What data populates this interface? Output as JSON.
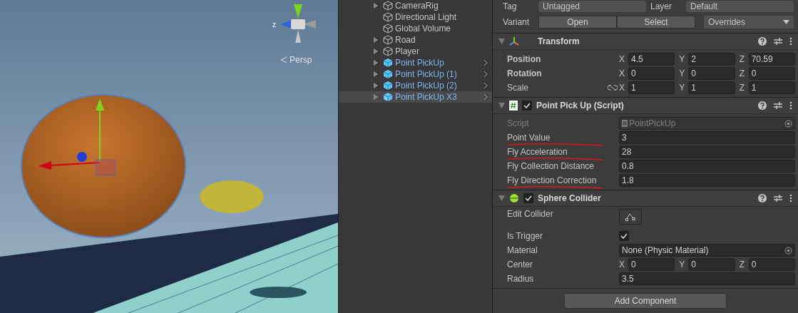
{
  "scene": {
    "axis_label": "z",
    "projection": "Persp"
  },
  "hierarchy": {
    "items": [
      {
        "name": "CameraRig",
        "kind": "object",
        "expandable": true,
        "submenu": false,
        "selected": false
      },
      {
        "name": "Directional Light",
        "kind": "object",
        "expandable": false,
        "submenu": false,
        "selected": false
      },
      {
        "name": "Global Volume",
        "kind": "object",
        "expandable": false,
        "submenu": false,
        "selected": false
      },
      {
        "name": "Road",
        "kind": "object",
        "expandable": true,
        "submenu": false,
        "selected": false
      },
      {
        "name": "Player",
        "kind": "object",
        "expandable": true,
        "submenu": false,
        "selected": false
      },
      {
        "name": "Point PickUp",
        "kind": "prefab",
        "expandable": true,
        "submenu": true,
        "selected": false
      },
      {
        "name": "Point PickUp (1)",
        "kind": "prefab",
        "expandable": true,
        "submenu": true,
        "selected": false
      },
      {
        "name": "Point PickUp (2)",
        "kind": "prefab",
        "expandable": true,
        "submenu": true,
        "selected": false
      },
      {
        "name": "Point PickUp X3",
        "kind": "variant",
        "expandable": true,
        "submenu": true,
        "selected": true
      }
    ]
  },
  "inspector": {
    "tag": {
      "label": "Tag",
      "value": "Untagged"
    },
    "layer": {
      "label": "Layer",
      "value": "Default"
    },
    "variant": {
      "label": "Variant",
      "buttons": [
        "Open",
        "Select"
      ],
      "overrides": "Overrides"
    },
    "components": [
      {
        "title": "Transform",
        "kind": "transform",
        "rows": [
          {
            "kind": "vector",
            "label": "Position",
            "bold": true,
            "axes": [
              {
                "axis": "X",
                "value": "4.5"
              },
              {
                "axis": "Y",
                "value": "2"
              },
              {
                "axis": "Z",
                "value": "70.59"
              }
            ]
          },
          {
            "kind": "vector",
            "label": "Rotation",
            "bold": true,
            "axes": [
              {
                "axis": "X",
                "value": "0"
              },
              {
                "axis": "Y",
                "value": "0"
              },
              {
                "axis": "Z",
                "value": "0"
              }
            ]
          },
          {
            "kind": "vector",
            "label": "Scale",
            "bold": false,
            "linked": true,
            "axes": [
              {
                "axis": "X",
                "value": "1"
              },
              {
                "axis": "Y",
                "value": "1"
              },
              {
                "axis": "Z",
                "value": "1"
              }
            ]
          }
        ]
      },
      {
        "title": "Point Pick Up (Script)",
        "kind": "script",
        "enabled": true,
        "rows": [
          {
            "kind": "object",
            "label": "Script",
            "disabled": true,
            "value": "PointPickUp"
          },
          {
            "kind": "field",
            "label": "Point Value",
            "value": "3",
            "underlined": true
          },
          {
            "kind": "field",
            "label": "Fly Acceleration",
            "value": "28",
            "underlined": true
          },
          {
            "kind": "field",
            "label": "Fly Collection Distance",
            "value": "0.8"
          },
          {
            "kind": "field",
            "label": "Fly Direction Correction",
            "value": "1.8",
            "underlined": true
          }
        ]
      },
      {
        "title": "Sphere Collider",
        "kind": "sphere",
        "enabled": true,
        "rows": [
          {
            "kind": "edit",
            "label": "Edit Collider"
          },
          {
            "kind": "checkbox",
            "label": "Is Trigger",
            "checked": true
          },
          {
            "kind": "object",
            "label": "Material",
            "disabled": false,
            "value": "None (Physic Material)"
          },
          {
            "kind": "vector",
            "label": "Center",
            "bold": false,
            "axes": [
              {
                "axis": "X",
                "value": "0"
              },
              {
                "axis": "Y",
                "value": "0"
              },
              {
                "axis": "Z",
                "value": "0"
              }
            ]
          },
          {
            "kind": "field",
            "label": "Radius",
            "value": "3.5"
          }
        ]
      }
    ],
    "add_button": "Add Component"
  }
}
